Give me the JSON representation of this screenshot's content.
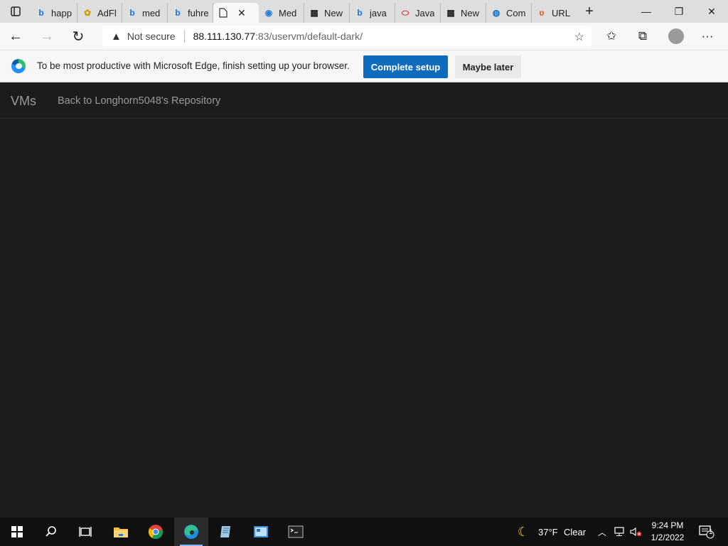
{
  "browser": {
    "tabs": [
      {
        "label": "happ",
        "icon": "bing-icon"
      },
      {
        "label": "AdFl",
        "icon": "adfly-icon"
      },
      {
        "label": "med",
        "icon": "bing-icon"
      },
      {
        "label": "fuhre",
        "icon": "bing-icon"
      },
      {
        "label": "",
        "icon": "page-icon",
        "active": true
      },
      {
        "label": "Med",
        "icon": "med-icon"
      },
      {
        "label": "New",
        "icon": "newtab-icon"
      },
      {
        "label": "java",
        "icon": "bing-icon"
      },
      {
        "label": "Java",
        "icon": "oracle-icon"
      },
      {
        "label": "New",
        "icon": "newtab-icon"
      },
      {
        "label": "Com",
        "icon": "location-icon"
      },
      {
        "label": "URL",
        "icon": "url-icon"
      }
    ],
    "address": {
      "security_label": "Not secure",
      "url_host": "88.111.130.77",
      "url_rest": ":83/uservm/default-dark/"
    }
  },
  "infobar": {
    "message": "To be most productive with Microsoft Edge, finish setting up your browser.",
    "primary_label": "Complete setup",
    "secondary_label": "Maybe later"
  },
  "page": {
    "brand": "VMs",
    "back_link": "Back to Longhorn5048's Repository"
  },
  "taskbar": {
    "weather_temp": "37°F",
    "weather_desc": "Clear",
    "time": "9:24 PM",
    "date": "1/2/2022",
    "notification_count": "1"
  },
  "colors": {
    "page_background": "#1b1c1e",
    "primary_button": "#0f6cbd",
    "muted_text": "#9a9a9a"
  }
}
